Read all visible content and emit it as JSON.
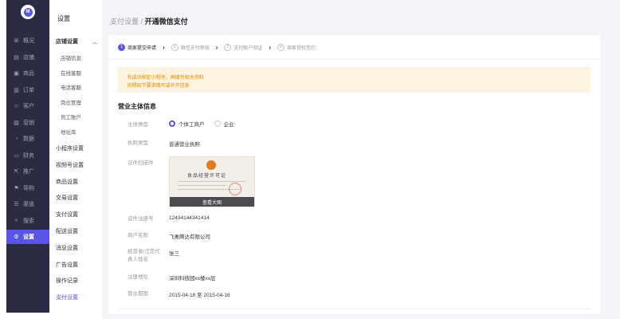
{
  "colors": {
    "accent": "#5b55e6",
    "rail_bg": "#2b2c44",
    "notice_bg": "#fdf3e1",
    "notice_text": "#e08a00"
  },
  "rail": {
    "items": [
      {
        "icon": "grid-icon",
        "glyph": "⊞",
        "label": "概况"
      },
      {
        "icon": "store-icon",
        "glyph": "▤",
        "label": "店铺"
      },
      {
        "icon": "product-icon",
        "glyph": "▣",
        "label": "商品"
      },
      {
        "icon": "order-icon",
        "glyph": "▥",
        "label": "订单"
      },
      {
        "icon": "customer-icon",
        "glyph": "☺",
        "label": "客户"
      },
      {
        "icon": "marketing-icon",
        "glyph": "▧",
        "label": "营销"
      },
      {
        "icon": "data-icon",
        "glyph": "◔",
        "label": "数据"
      },
      {
        "icon": "finance-icon",
        "glyph": "▭",
        "label": "财务"
      },
      {
        "icon": "promote-icon",
        "glyph": "⇱",
        "label": "推广"
      },
      {
        "icon": "guide-icon",
        "glyph": "⚑",
        "label": "导购"
      },
      {
        "icon": "channel-icon",
        "glyph": "☰",
        "label": "渠道"
      },
      {
        "icon": "search-icon",
        "glyph": "⌕",
        "label": "搜索"
      },
      {
        "icon": "gear-icon",
        "glyph": "⚙",
        "label": "设置"
      }
    ]
  },
  "submenu": {
    "title": "设置",
    "group": "店铺设置",
    "group_children": [
      "店铺信息",
      "在线客服",
      "电话客服",
      "岗位管理",
      "员工账户",
      "地址库"
    ],
    "items": [
      "小程序设置",
      "视频号设置",
      "商品设置",
      "交易设置",
      "支付设置",
      "配送设置",
      "消息设置",
      "广告设置",
      "操作记录",
      "支付设置"
    ]
  },
  "breadcrumb": {
    "parent": "支付设置",
    "sep": "/",
    "current": "开通微信支付"
  },
  "steps": [
    {
      "num": "1",
      "label": "商家提交申请"
    },
    {
      "num": "2",
      "label": "微信支付审核"
    },
    {
      "num": "3",
      "label": "支付账户验证"
    },
    {
      "num": "4",
      "label": "商家授权签约"
    }
  ],
  "notice": {
    "line1": "· 先成功绑定小程序，再填写相关资料",
    "line2": "· 按照如下要求填写或补齐信息"
  },
  "section_title": "营业主体信息",
  "form": {
    "subject_type_label": "主体类型",
    "subject_options": [
      "个体工商户",
      "企业"
    ],
    "license_type_label": "执照类型",
    "license_type_value": "普通营业执照",
    "scan_label": "证件扫描件",
    "license_title": "食品经营许可证",
    "view_label": "查看大图",
    "reg_no_label": "证件注册号",
    "reg_no_value": "12434144341414",
    "merchant_label": "商户名称",
    "merchant_value": "飞禽腾达有限公司",
    "operator_label": "经营者/法定代表人姓名",
    "operator_value": "张三",
    "address_label": "注册地址",
    "address_value": "深圳科技园xx楼xx层",
    "period_label": "营业期限",
    "period_value": "2015-04-18  至  2015-04-18"
  }
}
